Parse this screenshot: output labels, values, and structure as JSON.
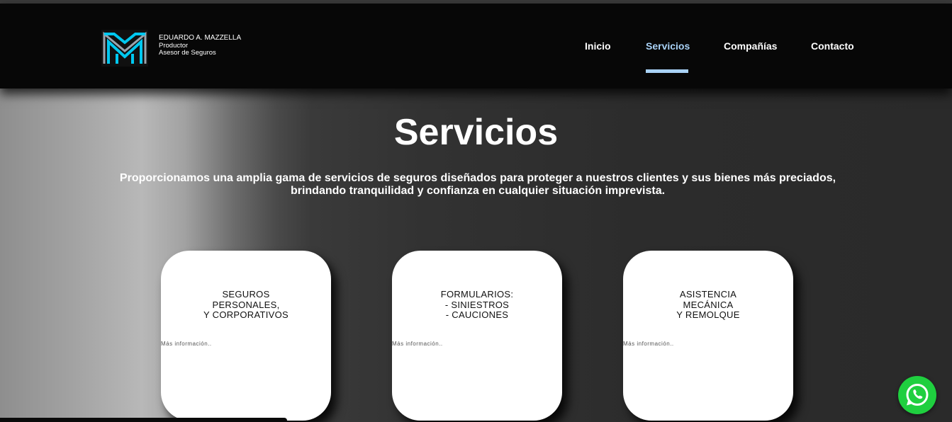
{
  "header": {
    "brand": {
      "name": "EDUARDO A. MAZZELLA",
      "line2": "Productor",
      "line3": "Asesor de Seguros"
    },
    "nav": [
      {
        "label": "Inicio",
        "active": false
      },
      {
        "label": "Servicios",
        "active": true
      },
      {
        "label": "Compañías",
        "active": false
      },
      {
        "label": "Contacto",
        "active": false
      }
    ]
  },
  "hero": {
    "title": "Servicios",
    "line1": "Proporcionamos una amplia gama de servicios de seguros diseñados para proteger a nuestros clientes y sus bienes más preciados,",
    "line2": "brindando tranquilidad y confianza en cualquier situación imprevista."
  },
  "cards": [
    {
      "lines": [
        "SEGUROS",
        "PERSONALES,",
        "Y CORPORATIVOS"
      ],
      "more": "Más información.."
    },
    {
      "lines": [
        "FORMULARIOS:",
        "- SINIESTROS",
        "- CAUCIONES"
      ],
      "more": "Más información.."
    },
    {
      "lines": [
        "ASISTENCIA",
        "MECÁNICA",
        "Y REMOLQUE"
      ],
      "more": "Más información.."
    }
  ],
  "icons": {
    "logo": "mm-monogram-logo",
    "whatsapp": "whatsapp-icon"
  },
  "colors": {
    "accent": "#a9d2f7",
    "logo": "#00c8f0",
    "whatsapp": "#1fcf3f"
  }
}
